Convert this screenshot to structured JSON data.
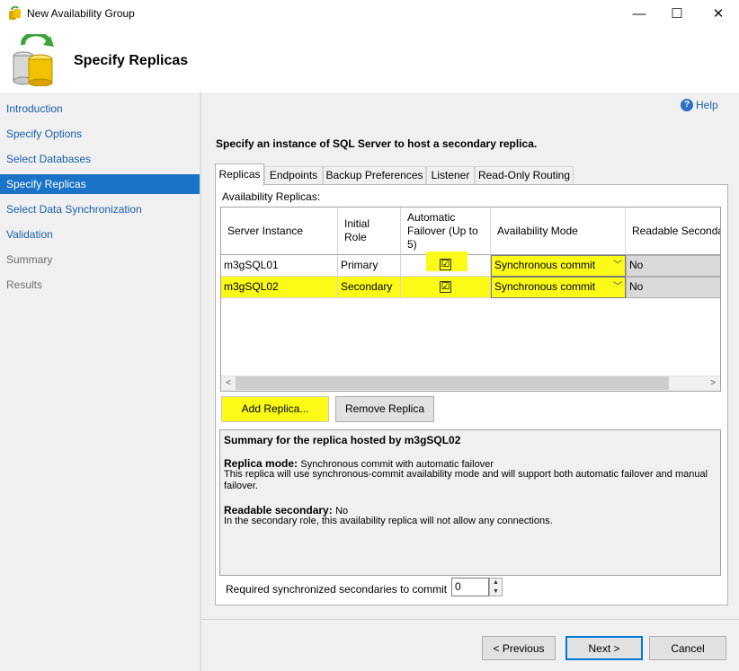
{
  "window": {
    "title": "New Availability Group",
    "minimize": "—",
    "maximize": "☐",
    "close": "✕"
  },
  "header": {
    "title": "Specify Replicas"
  },
  "sidebar": {
    "items": [
      {
        "label": "Introduction",
        "state": "link"
      },
      {
        "label": "Specify Options",
        "state": "link"
      },
      {
        "label": "Select Databases",
        "state": "link"
      },
      {
        "label": "Specify Replicas",
        "state": "active"
      },
      {
        "label": "Select Data Synchronization",
        "state": "link"
      },
      {
        "label": "Validation",
        "state": "link"
      },
      {
        "label": "Summary",
        "state": "disabled"
      },
      {
        "label": "Results",
        "state": "disabled"
      }
    ]
  },
  "main": {
    "help_icon": "?",
    "help_label": "Help",
    "instruction": "Specify an instance of SQL Server to host a secondary replica.",
    "tabs": [
      {
        "label": "Replicas",
        "active": true
      },
      {
        "label": "Endpoints",
        "active": false
      },
      {
        "label": "Backup Preferences",
        "active": false
      },
      {
        "label": "Listener",
        "active": false
      },
      {
        "label": "Read-Only Routing",
        "active": false
      }
    ],
    "availability_replicas_label": "Availability Replicas:",
    "grid": {
      "columns": {
        "server_instance": "Server Instance",
        "initial_role_1": "Initial",
        "initial_role_2": "Role",
        "auto_failover_1": "Automatic",
        "auto_failover_2": "Failover (Up to",
        "auto_failover_3": "5)",
        "availability_mode": "Availability Mode",
        "readable_secondary": "Readable Secondar"
      },
      "rows": [
        {
          "server": "m3gSQL01",
          "role": "Primary",
          "auto_failover": "☑",
          "mode": "Synchronous commit",
          "readable": "No"
        },
        {
          "server": "m3gSQL02",
          "role": "Secondary",
          "auto_failover": "☑",
          "mode": "Synchronous commit",
          "readable": "No"
        }
      ],
      "scroll_left": "<",
      "scroll_right": ">"
    },
    "add_replica": "Add Replica...",
    "remove_replica": "Remove Replica",
    "summary": {
      "title": "Summary for the replica hosted by m3gSQL02",
      "mode_label": "Replica mode:",
      "mode_value": "Synchronous commit with automatic failover",
      "mode_desc_1": "This replica will use synchronous-commit availability mode and will support both automatic failover and manual",
      "mode_desc_2": "failover.",
      "readable_label": "Readable secondary:",
      "readable_value": "No",
      "readable_desc": "In the secondary role, this availability replica will not allow any connections."
    },
    "required_label": "Required synchronized secondaries to commit",
    "required_value": "0"
  },
  "footer": {
    "previous": "< Previous",
    "next": "Next >",
    "cancel": "Cancel"
  }
}
